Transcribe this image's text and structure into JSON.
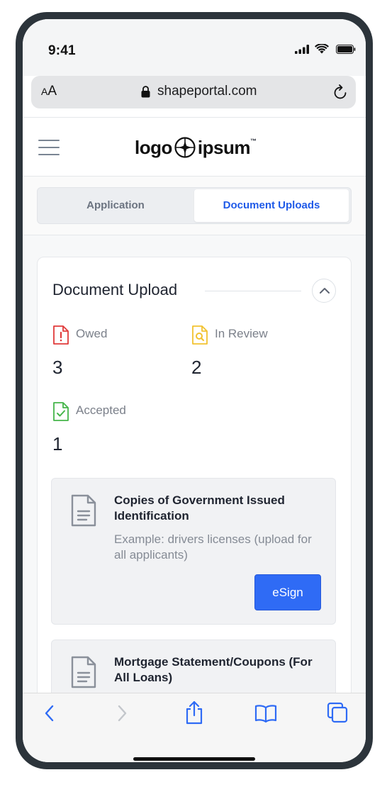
{
  "status_bar": {
    "time": "9:41"
  },
  "browser": {
    "text_size_label": "AA",
    "url": "shapeportal.com"
  },
  "header": {
    "logo_left": "logo",
    "logo_right": "ipsum",
    "logo_tm": "™"
  },
  "tabs": [
    {
      "label": "Application",
      "active": false
    },
    {
      "label": "Document Uploads",
      "active": true
    }
  ],
  "document_upload": {
    "title": "Document Upload",
    "stats": {
      "owed": {
        "label": "Owed",
        "count": "3",
        "color": "#e03b3b"
      },
      "in_review": {
        "label": "In Review",
        "count": "2",
        "color": "#f2c230"
      },
      "accepted": {
        "label": "Accepted",
        "count": "1",
        "color": "#45b54a"
      }
    },
    "items": [
      {
        "title": "Copies of Government Issued Identification",
        "description": "Example: drivers licenses (upload for all applicants)",
        "button_label": "eSign"
      },
      {
        "title": "Mortgage Statement/Coupons (For All Loans)"
      }
    ]
  },
  "colors": {
    "accent": "#2f6bf5",
    "tab_active": "#1f5ae8",
    "ios_blue": "#2f6bf5"
  },
  "icons": {
    "back": "chevron-left-icon",
    "forward": "chevron-right-icon",
    "share": "share-icon",
    "bookmarks": "book-icon",
    "tabs": "tabs-icon",
    "lock": "lock-icon",
    "reload": "reload-icon"
  }
}
